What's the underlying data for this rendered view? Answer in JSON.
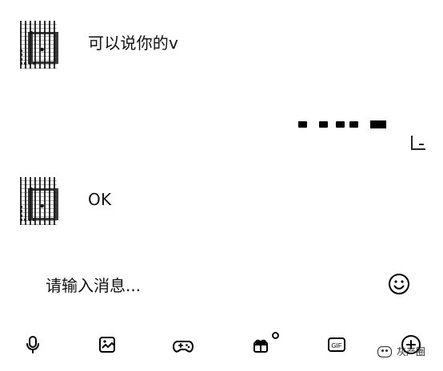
{
  "conversation": {
    "messages": [
      {
        "side": "left",
        "text": "可以说你的v"
      },
      {
        "side": "left",
        "text": "OK"
      }
    ]
  },
  "composer": {
    "placeholder": "请输入消息..."
  },
  "toolbar": {
    "icons": [
      "microphone-icon",
      "image-icon",
      "game-controller-icon",
      "gift-icon",
      "gif-icon",
      "plus-icon"
    ],
    "gif_label": "GIF"
  },
  "watermark": {
    "text": "灰产圈"
  }
}
